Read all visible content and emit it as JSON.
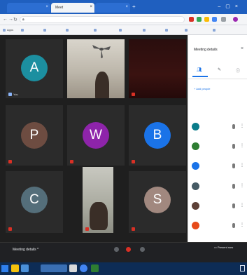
{
  "colors": {
    "tab_strip": "#1f5fbf",
    "stage_bg": "#1f1f1f",
    "accent": "#1a73e8",
    "end_call": "#d93025",
    "taskbar": "#0d2c55"
  },
  "browser": {
    "tabs": [
      {
        "label": "",
        "active": false
      },
      {
        "label": "Meet",
        "active": true
      },
      {
        "label": "",
        "active": false
      }
    ],
    "new_tab_icon": "plus-icon",
    "address": "",
    "bookmarks": [
      "Apps",
      "",
      "",
      "",
      "",
      "",
      "",
      "",
      "",
      ""
    ]
  },
  "tiles": [
    {
      "kind": "avatar",
      "letter": "A",
      "color": "#1c8fa0",
      "name": "You"
    },
    {
      "kind": "video",
      "name": ""
    },
    {
      "kind": "video",
      "name": ""
    },
    {
      "kind": "avatar",
      "letter": "P",
      "color": "#6d4c41",
      "name": ""
    },
    {
      "kind": "avatar",
      "letter": "W",
      "color": "#8e24aa",
      "name": ""
    },
    {
      "kind": "avatar",
      "letter": "B",
      "color": "#1a73e8",
      "name": ""
    },
    {
      "kind": "avatar",
      "letter": "C",
      "color": "#546e7a",
      "name": ""
    },
    {
      "kind": "video",
      "name": ""
    },
    {
      "kind": "avatar",
      "letter": "S",
      "color": "#a1887f",
      "name": ""
    }
  ],
  "callbar": {
    "title": "Meeting details",
    "present": "Present now"
  },
  "panel": {
    "title": "Meeting details",
    "tabs": [
      "",
      "",
      ""
    ],
    "add_people": "Add people",
    "section": "",
    "people": [
      {
        "name": "",
        "color": "#0a7c8a"
      },
      {
        "name": "",
        "color": "#2e7d32"
      },
      {
        "name": "",
        "color": "#1a73e8"
      },
      {
        "name": "",
        "color": "#455a64"
      },
      {
        "name": "",
        "color": "#5d4037"
      },
      {
        "name": "",
        "color": "#e64a19"
      }
    ]
  },
  "taskbar": {
    "icons": [
      "#f4c20d",
      "#4a90d9",
      "#3a6fb3",
      "#d9d9d9",
      "#4285f4",
      "#2e7d32"
    ],
    "tray": ""
  }
}
